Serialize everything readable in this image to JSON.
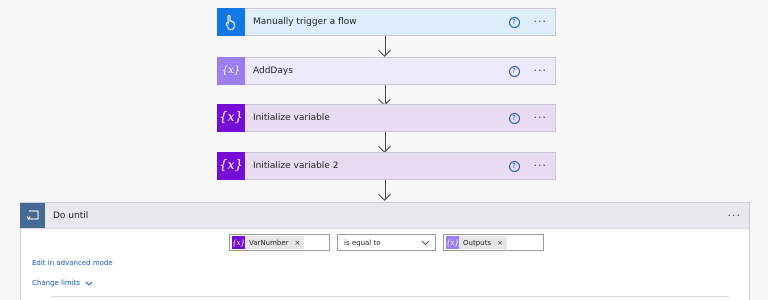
{
  "colors": {
    "trigger_bg": "#dfeefd",
    "trigger_icon": "#1377e6",
    "compose_bg": "#eeeafd",
    "compose_icon": "#9b7ef0",
    "variable_bg": "#e8dcf5",
    "variable_icon": "#770bd6",
    "dountil_icon": "#486991"
  },
  "steps": [
    {
      "title": "Manually trigger a flow",
      "icon": "hand-pointer-icon"
    },
    {
      "title": "AddDays",
      "icon": "expression-icon"
    },
    {
      "title": "Initialize variable",
      "icon": "variable-icon"
    },
    {
      "title": "Initialize variable 2",
      "icon": "variable-icon"
    }
  ],
  "step_help_glyph": "?",
  "more_glyph": "···",
  "do_until": {
    "title": "Do until",
    "condition": {
      "left_token": "VarNumber",
      "operator": "is equal to",
      "right_token": "Outputs",
      "remove_glyph": "×"
    },
    "edit_advanced_link": "Edit in advanced mode",
    "change_limits_link": "Change limits"
  },
  "icon_glyphs": {
    "variable": "{x}",
    "expression": "{𝑥}"
  }
}
